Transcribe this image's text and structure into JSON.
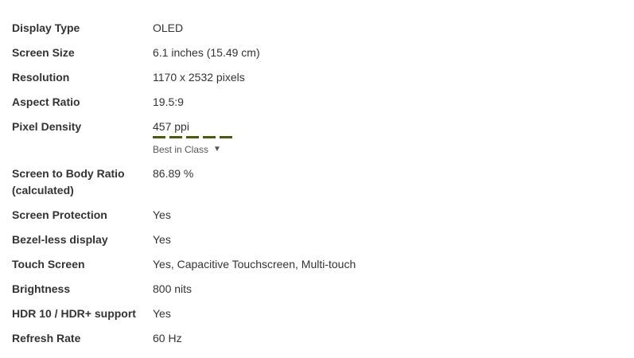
{
  "specs": [
    {
      "label": "Display Type",
      "value": "OLED"
    },
    {
      "label": "Screen Size",
      "value": "6.1 inches (15.49 cm)"
    },
    {
      "label": "Resolution",
      "value": "1170 x 2532 pixels"
    },
    {
      "label": "Aspect Ratio",
      "value": "19.5:9"
    },
    {
      "label": "Pixel Density",
      "value": "457 ppi",
      "rating_segments": 5,
      "rating_label": "Best in Class",
      "rating_caret": "▼",
      "rating_color": "#4a5a10"
    },
    {
      "label": "Screen to Body Ratio (calculated)",
      "value": "86.89 %"
    },
    {
      "label": "Screen Protection",
      "value": "Yes"
    },
    {
      "label": "Bezel-less display",
      "value": "Yes"
    },
    {
      "label": "Touch Screen",
      "value": "Yes, Capacitive Touchscreen, Multi-touch"
    },
    {
      "label": "Brightness",
      "value": "800 nits"
    },
    {
      "label": "HDR 10 / HDR+ support",
      "value": "Yes"
    },
    {
      "label": "Refresh Rate",
      "value": "60 Hz"
    }
  ]
}
